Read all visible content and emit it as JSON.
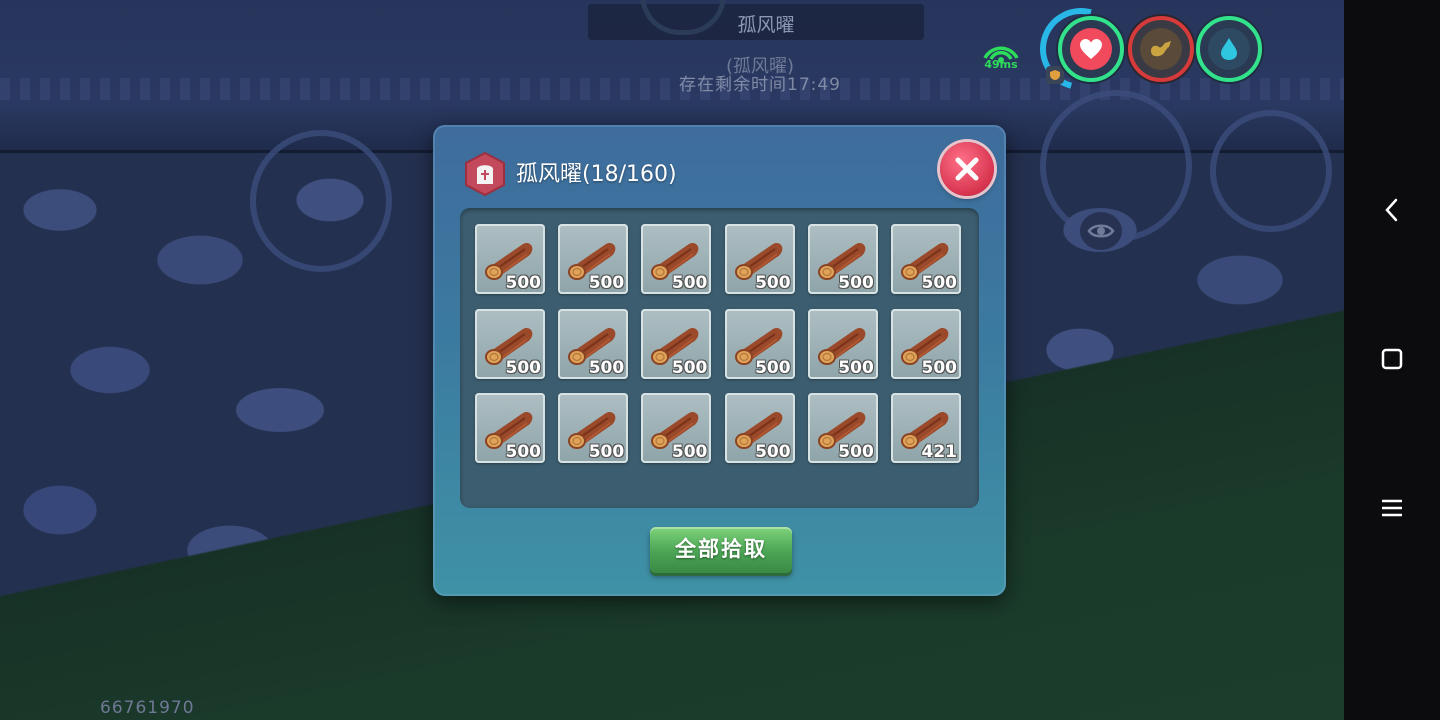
{
  "hud": {
    "top_name": "孤风曜",
    "sub_name": "(孤风曜)",
    "timer": "存在剩余时间17:49",
    "ping": "49ms",
    "player_id": "66761970",
    "stats": [
      {
        "name": "health",
        "icon": "heart-icon"
      },
      {
        "name": "hunger",
        "icon": "stomach-icon"
      },
      {
        "name": "water",
        "icon": "water-drop-icon"
      }
    ]
  },
  "loot_panel": {
    "title": "孤风曜(18/160)",
    "pickup_all_label": "全部拾取",
    "items": [
      {
        "item": "wood-log",
        "qty": "500"
      },
      {
        "item": "wood-log",
        "qty": "500"
      },
      {
        "item": "wood-log",
        "qty": "500"
      },
      {
        "item": "wood-log",
        "qty": "500"
      },
      {
        "item": "wood-log",
        "qty": "500"
      },
      {
        "item": "wood-log",
        "qty": "500"
      },
      {
        "item": "wood-log",
        "qty": "500"
      },
      {
        "item": "wood-log",
        "qty": "500"
      },
      {
        "item": "wood-log",
        "qty": "500"
      },
      {
        "item": "wood-log",
        "qty": "500"
      },
      {
        "item": "wood-log",
        "qty": "500"
      },
      {
        "item": "wood-log",
        "qty": "500"
      },
      {
        "item": "wood-log",
        "qty": "500"
      },
      {
        "item": "wood-log",
        "qty": "500"
      },
      {
        "item": "wood-log",
        "qty": "500"
      },
      {
        "item": "wood-log",
        "qty": "500"
      },
      {
        "item": "wood-log",
        "qty": "500"
      },
      {
        "item": "wood-log",
        "qty": "421"
      }
    ]
  },
  "colors": {
    "panel": "#3f7aa0",
    "close": "#d7344e",
    "pickup_button": "#4aa454",
    "stat_ring_green": "#33e38c",
    "stat_ring_red": "#d63a3a",
    "ping": "#2ddc5a"
  },
  "nav": [
    {
      "name": "back",
      "icon": "chevron-left-icon"
    },
    {
      "name": "home",
      "icon": "square-icon"
    },
    {
      "name": "menu",
      "icon": "hamburger-menu-icon"
    }
  ]
}
